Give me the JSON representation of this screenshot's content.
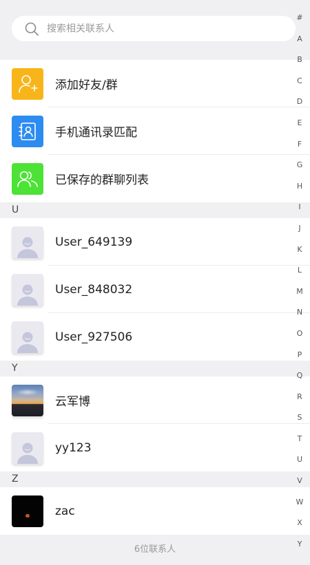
{
  "search": {
    "placeholder": "搜索相关联系人"
  },
  "actions": [
    {
      "label": "添加好友/群",
      "icon": "add-friend-icon",
      "color": "#f8b51a"
    },
    {
      "label": "手机通讯录匹配",
      "icon": "phone-contacts-icon",
      "color": "#2d8cf0"
    },
    {
      "label": "已保存的群聊列表",
      "icon": "saved-groups-icon",
      "color": "#4de236"
    }
  ],
  "sections": [
    {
      "letter": "U",
      "contacts": [
        {
          "name": "User_649139",
          "avatar": "default-avatar"
        },
        {
          "name": "User_848032",
          "avatar": "default-avatar"
        },
        {
          "name": "User_927506",
          "avatar": "default-avatar"
        }
      ]
    },
    {
      "letter": "Y",
      "contacts": [
        {
          "name": "云军博",
          "avatar": "photo-avatar"
        },
        {
          "name": "yy123",
          "avatar": "default-avatar"
        }
      ]
    },
    {
      "letter": "Z",
      "contacts": [
        {
          "name": "zac",
          "avatar": "photo-avatar"
        }
      ]
    }
  ],
  "footer": {
    "count_text": "6位联系人"
  },
  "index": [
    "#",
    "A",
    "B",
    "C",
    "D",
    "E",
    "F",
    "G",
    "H",
    "I",
    "J",
    "K",
    "L",
    "M",
    "N",
    "O",
    "P",
    "Q",
    "R",
    "S",
    "T",
    "U",
    "V",
    "W",
    "X",
    "Y"
  ]
}
